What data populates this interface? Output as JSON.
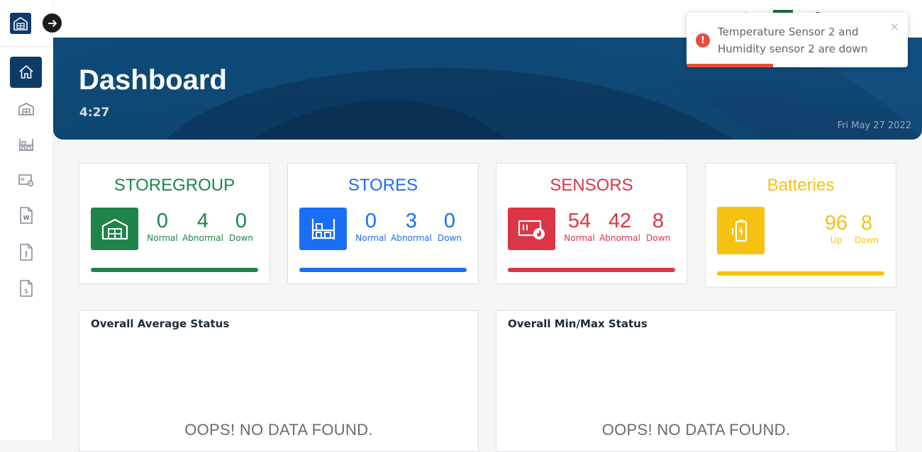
{
  "sidebar": {
    "items": [
      {
        "icon": "home-icon"
      },
      {
        "icon": "warehouse-icon"
      },
      {
        "icon": "shelves-icon"
      },
      {
        "icon": "sensor-icon"
      },
      {
        "icon": "word-doc-icon"
      },
      {
        "icon": "info-doc-icon"
      },
      {
        "icon": "dollar-doc-icon"
      }
    ]
  },
  "hero": {
    "title": "Dashboard",
    "time": "4:27",
    "date": "Fri May 27 2022"
  },
  "toast": {
    "icon": "!",
    "message": "Temperature Sensor 2 and Humidity sensor 2 are down",
    "close": "×",
    "progress": 0.39
  },
  "cards": {
    "storegroup": {
      "title": "STOREGROUP",
      "color": "#1e8449",
      "stats": [
        {
          "value": "0",
          "label": "Normal"
        },
        {
          "value": "4",
          "label": "Abnormal"
        },
        {
          "value": "0",
          "label": "Down"
        }
      ]
    },
    "stores": {
      "title": "STORES",
      "color": "#1a6ef5",
      "stats": [
        {
          "value": "0",
          "label": "Normal"
        },
        {
          "value": "3",
          "label": "Abnormal"
        },
        {
          "value": "0",
          "label": "Down"
        }
      ]
    },
    "sensors": {
      "title": "SENSORS",
      "color": "#dc3545",
      "stats": [
        {
          "value": "54",
          "label": "Normal"
        },
        {
          "value": "42",
          "label": "Abnormal"
        },
        {
          "value": "8",
          "label": "Down"
        }
      ]
    },
    "batteries": {
      "title": "Batteries",
      "color": "#f5c211",
      "stats": [
        {
          "value": "96",
          "label": "Up"
        },
        {
          "value": "8",
          "label": "Down"
        }
      ]
    }
  },
  "panels": {
    "average": {
      "title": "Overall Average Status",
      "empty": "OOPS! NO DATA FOUND."
    },
    "minmax": {
      "title": "Overall Min/Max Status",
      "empty": "OOPS! NO DATA FOUND."
    }
  },
  "colors": {
    "navy": "#0d3b66",
    "toast_error": "#e74c3c"
  }
}
